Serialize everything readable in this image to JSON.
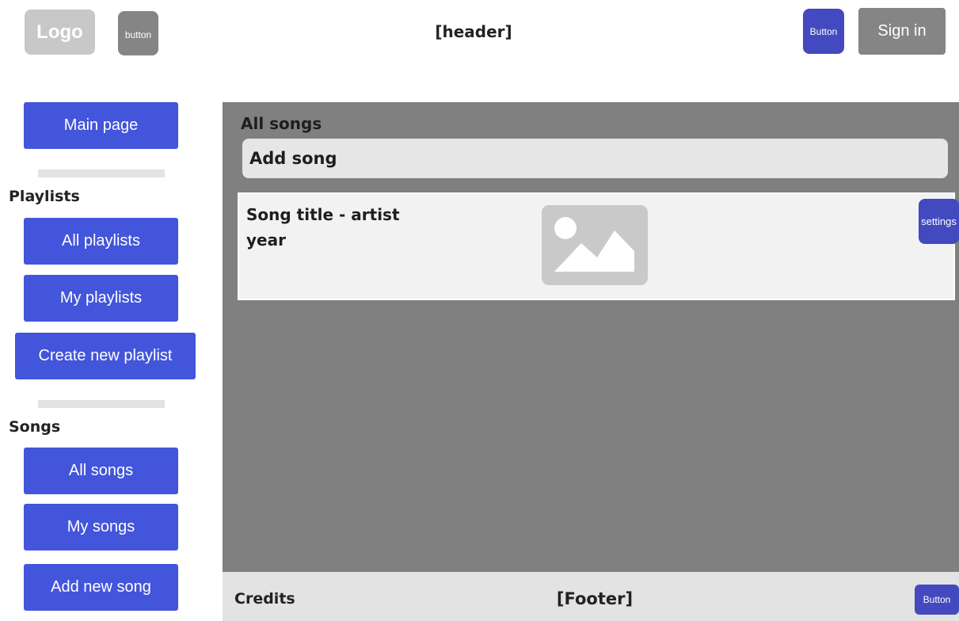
{
  "header": {
    "logo": "Logo",
    "small_button": "button",
    "title": "[header]",
    "button": "Button",
    "sign_in": "Sign in"
  },
  "sidebar": {
    "main_page": "Main page",
    "playlists_heading": "Playlists",
    "all_playlists": "All playlists",
    "my_playlists": "My playlists",
    "create_playlist": "Create new playlist",
    "songs_heading": "Songs",
    "all_songs": "All songs",
    "my_songs": "My songs",
    "add_new_song": "Add new song"
  },
  "main": {
    "title": "All songs",
    "add_song": "Add song",
    "song": {
      "title_artist": "Song title - artist",
      "year": "year",
      "settings": "settings"
    }
  },
  "footer": {
    "credits": "Credits",
    "title": "[Footer]",
    "button": "Button"
  },
  "colors": {
    "primary": "#4355db",
    "accent_dark": "#4349bf",
    "gray_button": "#858585",
    "main_bg": "#808080",
    "panel_light": "#e6e6e6"
  }
}
